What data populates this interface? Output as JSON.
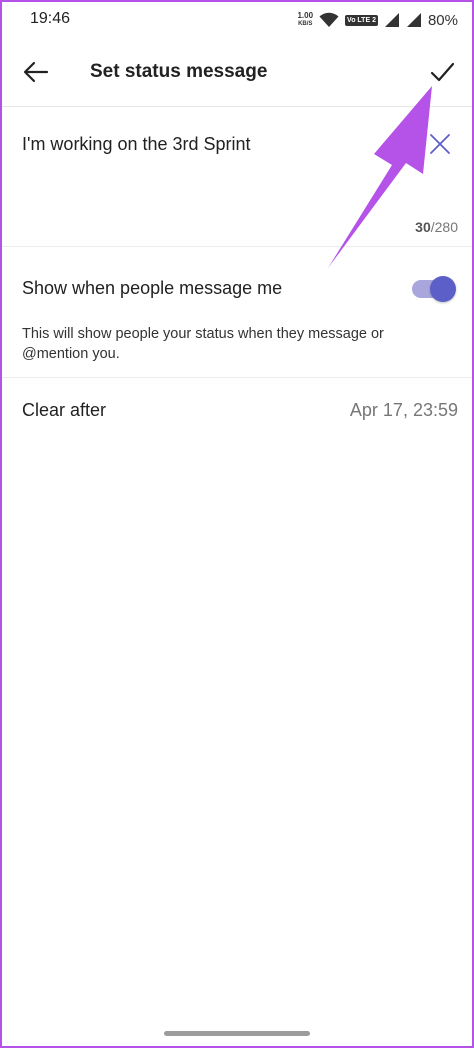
{
  "statusbar": {
    "time": "19:46",
    "speed_value": "1.00",
    "speed_unit": "KB/S",
    "volte": "Vo LTE 2",
    "battery": "80%"
  },
  "appbar": {
    "title": "Set status message"
  },
  "message": {
    "text": "I'm working on the 3rd Sprint",
    "count": "30",
    "limit": "/280"
  },
  "show_toggle": {
    "label": "Show when people message me",
    "checked": true,
    "helper": "This will show people your status when they message or @mention you."
  },
  "clear_after": {
    "label": "Clear after",
    "value": "Apr 17, 23:59"
  },
  "colors": {
    "accent": "#5b5fc7",
    "annotation": "#b552e8"
  }
}
